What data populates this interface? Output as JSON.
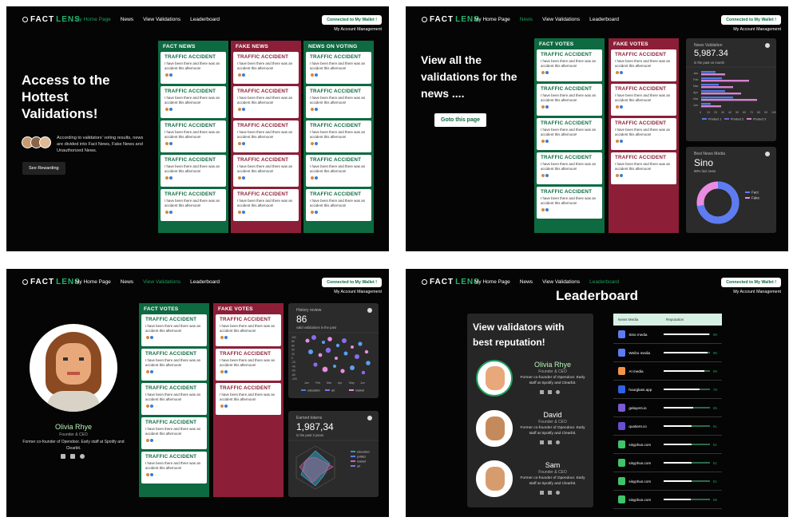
{
  "nav": {
    "logo_fact": "FACT",
    "logo_lens": "LENS",
    "links": [
      "My Home Page",
      "News",
      "View Validations",
      "Leaderboard"
    ],
    "wallet": "Connected to My Wallet !",
    "account": "My Account Management"
  },
  "card": {
    "title": "TRAFFIC ACCIDENT",
    "body": "I have been there and there was an accident this afternoon!"
  },
  "panel1": {
    "hero": [
      "Access to the",
      "Hottest",
      "Validations!"
    ],
    "desc": "According to validators' voting results, news are divided into Fact News, Fake News and Unauthorized News.",
    "button": "See Rewarding",
    "columns": [
      "FACT NEWS",
      "FAKE NEWS",
      "NEWS ON VOTING"
    ]
  },
  "panel2": {
    "hero": [
      "View all the",
      "validations for the",
      "news ...."
    ],
    "button": "Goto this page",
    "columns": [
      "FACT VOTES",
      "FAKE VOTES"
    ],
    "widget1": {
      "title": "News Validation",
      "value": "5,987.34",
      "sub": "in the past on month",
      "y_labels": [
        "Jan",
        "Feb",
        "Mar",
        "Apr",
        "Mar",
        "Jun"
      ],
      "x_labels": [
        "0",
        "10",
        "20",
        "30",
        "40",
        "50",
        "60",
        "70",
        "80",
        "90",
        "100"
      ],
      "legend": [
        "Product 1",
        "Product 2",
        "Product 3"
      ]
    },
    "widget2": {
      "title": "Best News Media",
      "value": "Sino",
      "sub": "98% fact news",
      "legend": [
        "Fact",
        "Fake"
      ]
    }
  },
  "panel3": {
    "name": "Olivia Rhye",
    "role": "Founder & CEO",
    "bio": "Former co-founder of Opendoor. Early staff at Spotify and Clearbit.",
    "columns": [
      "FACT VOTES",
      "FAKE VOTES"
    ],
    "widget1": {
      "title": "History review",
      "value": "86",
      "sub": "valid validations in the past",
      "legend": [
        "education",
        "art",
        "market"
      ],
      "x_labels": [
        "Jan",
        "Feb",
        "Mar",
        "Apr",
        "May",
        "Jun"
      ],
      "y_labels": [
        "100",
        "80",
        "60",
        "40",
        "20",
        "0",
        "-20",
        "-40",
        "-60",
        "-80",
        "-100"
      ]
    },
    "widget2": {
      "title": "Earned tokens",
      "value": "1,987,34",
      "sub": "in the past 3 years",
      "legend": [
        "education",
        "politics",
        "market",
        "art"
      ]
    }
  },
  "panel4": {
    "title": "Leaderboard",
    "card_title": [
      "View validators with",
      "best reputation!"
    ],
    "people": [
      {
        "name": "Olivia Rhye",
        "role": "Founder & CEO",
        "bio": "Former co-founder of Opendoor. Early staff at Spotify and Clearbit."
      },
      {
        "name": "David",
        "role": "Founder & CEO",
        "bio": "Former co-founder of Opendoor. Early staff at Spotify and Clearbit."
      },
      {
        "name": "Sam",
        "role": "Founder & CEO",
        "bio": "Former co-founder of Opendoor. Early staff at Spotify and Clearbit."
      }
    ],
    "table_head": [
      "News Media",
      "Reputation"
    ],
    "rows": [
      {
        "name": "Sino media",
        "score": 98
      },
      {
        "name": "Weibo media",
        "score": 95
      },
      {
        "name": "AI media",
        "score": 89
      },
      {
        "name": "hourglass.app",
        "score": 78
      },
      {
        "name": "gelayers.io",
        "score": 65
      },
      {
        "name": "quotient.co",
        "score": 61
      },
      {
        "name": "sisyphus.com",
        "score": 61
      },
      {
        "name": "sisyphus.com",
        "score": 61
      },
      {
        "name": "sisyphus.com",
        "score": 61
      },
      {
        "name": "sisyphus.com",
        "score": 59
      }
    ]
  }
}
